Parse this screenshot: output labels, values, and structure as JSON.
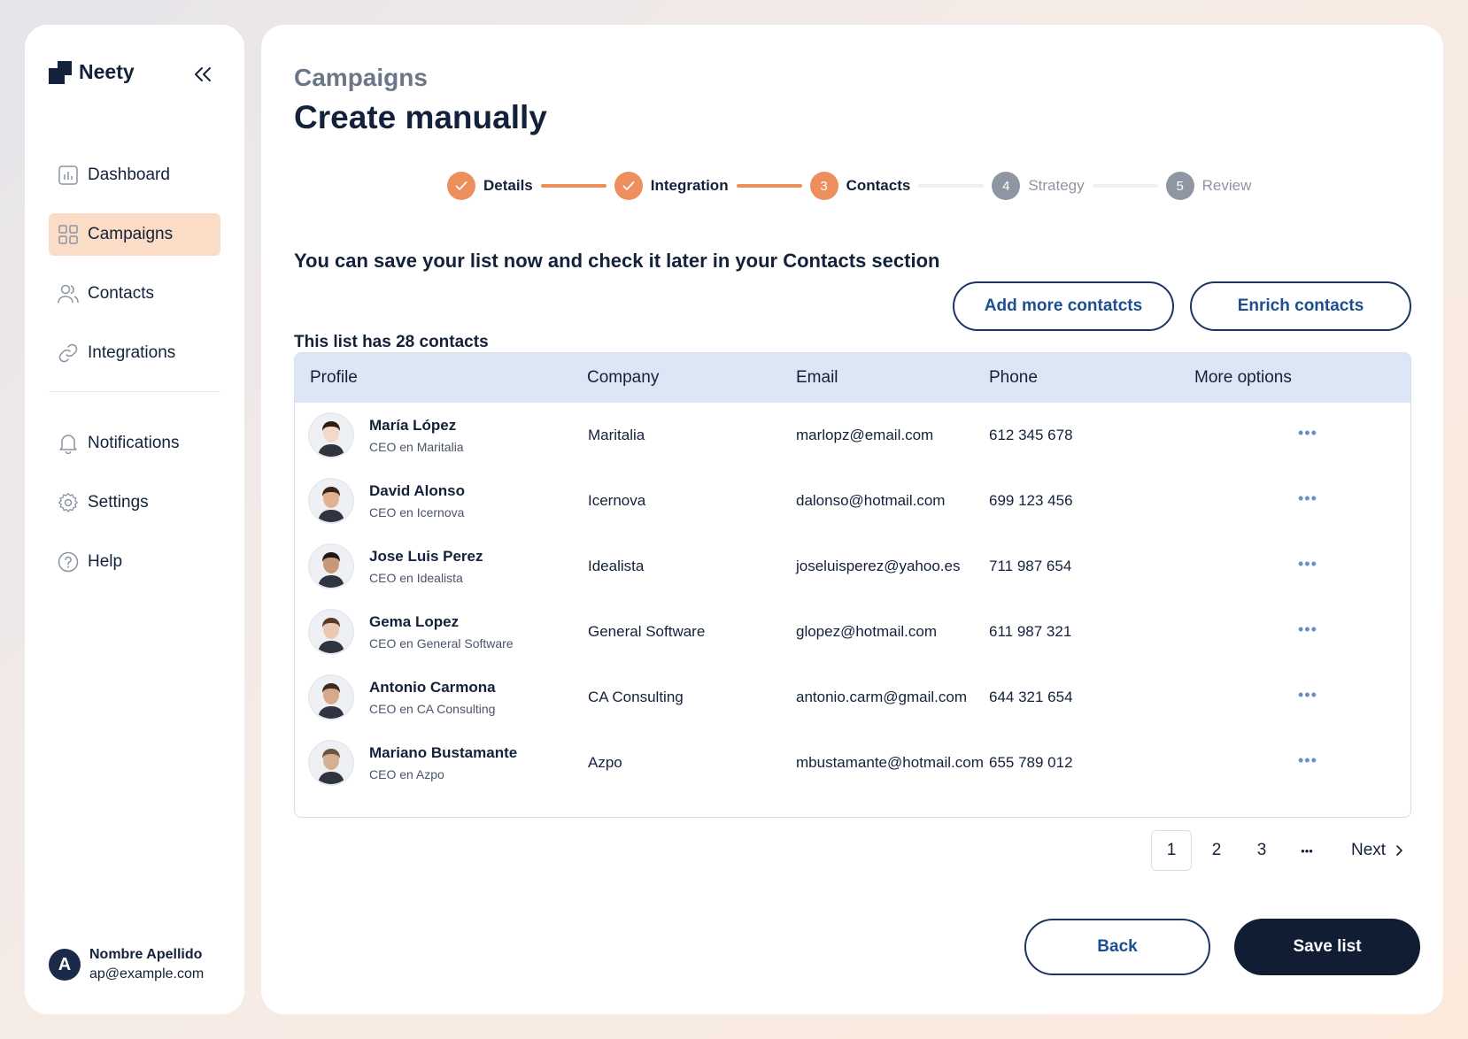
{
  "brand": {
    "name": "Neety"
  },
  "sidebar": {
    "items": [
      {
        "label": "Dashboard",
        "icon": "dashboard-icon"
      },
      {
        "label": "Campaigns",
        "icon": "grid-icon"
      },
      {
        "label": "Contacts",
        "icon": "users-icon"
      },
      {
        "label": "Integrations",
        "icon": "link-icon"
      }
    ],
    "secondary": [
      {
        "label": "Notifications",
        "icon": "bell-icon"
      },
      {
        "label": "Settings",
        "icon": "gear-icon"
      },
      {
        "label": "Help",
        "icon": "help-icon"
      }
    ]
  },
  "user": {
    "initial": "A",
    "name": "Nombre Apellido",
    "email": "ap@example.com"
  },
  "header": {
    "breadcrumb": "Campaigns",
    "title": "Create manually"
  },
  "stepper": [
    {
      "number": "1",
      "label": "Details",
      "state": "done"
    },
    {
      "number": "2",
      "label": "Integration",
      "state": "done"
    },
    {
      "number": "3",
      "label": "Contacts",
      "state": "current"
    },
    {
      "number": "4",
      "label": "Strategy",
      "state": "todo"
    },
    {
      "number": "5",
      "label": "Review",
      "state": "todo"
    }
  ],
  "info_text": "You can save your list now and check it later in your Contacts section",
  "count_text": "This list has 28 contacts",
  "actions": {
    "add_more": "Add more contatcts",
    "enrich": "Enrich contacts",
    "back": "Back",
    "save": "Save list"
  },
  "table": {
    "headers": {
      "profile": "Profile",
      "company": "Company",
      "email": "Email",
      "phone": "Phone",
      "more": "More options"
    },
    "rows": [
      {
        "name": "María López",
        "role": "CEO  en Maritalia",
        "company": "Maritalia",
        "email": "marlopz@email.com",
        "phone": "612 345 678",
        "more": "•••"
      },
      {
        "name": "David Alonso",
        "role": "CEO  en Icernova",
        "company": "Icernova",
        "email": "dalonso@hotmail.com",
        "phone": "699 123 456",
        "more": "•••"
      },
      {
        "name": "Jose Luis Perez",
        "role": "CEO  en Idealista",
        "company": "Idealista",
        "email": "joseluisperez@yahoo.es",
        "phone": "711 987 654",
        "more": "•••"
      },
      {
        "name": "Gema Lopez",
        "role": "CEO  en General Software",
        "company": "General Software",
        "email": "glopez@hotmail.com",
        "phone": "611 987 321",
        "more": "•••"
      },
      {
        "name": "Antonio Carmona",
        "role": "CEO  en CA Consulting",
        "company": "CA Consulting",
        "email": "antonio.carm@gmail.com",
        "phone": "644 321 654",
        "more": "•••"
      },
      {
        "name": "Mariano Bustamante",
        "role": "CEO  en Azpo",
        "company": "Azpo",
        "email": "mbustamante@hotmail.com",
        "phone": "655 789 012",
        "more": "•••"
      }
    ]
  },
  "pagination": {
    "pages": [
      "1",
      "2",
      "3"
    ],
    "ellipsis": "•••",
    "next": "Next",
    "current": "1"
  },
  "colors": {
    "accent": "#ed8f5c",
    "primary_dark": "#111d33",
    "active_nav": "#fbdcc7",
    "table_header": "#dce6f4"
  }
}
